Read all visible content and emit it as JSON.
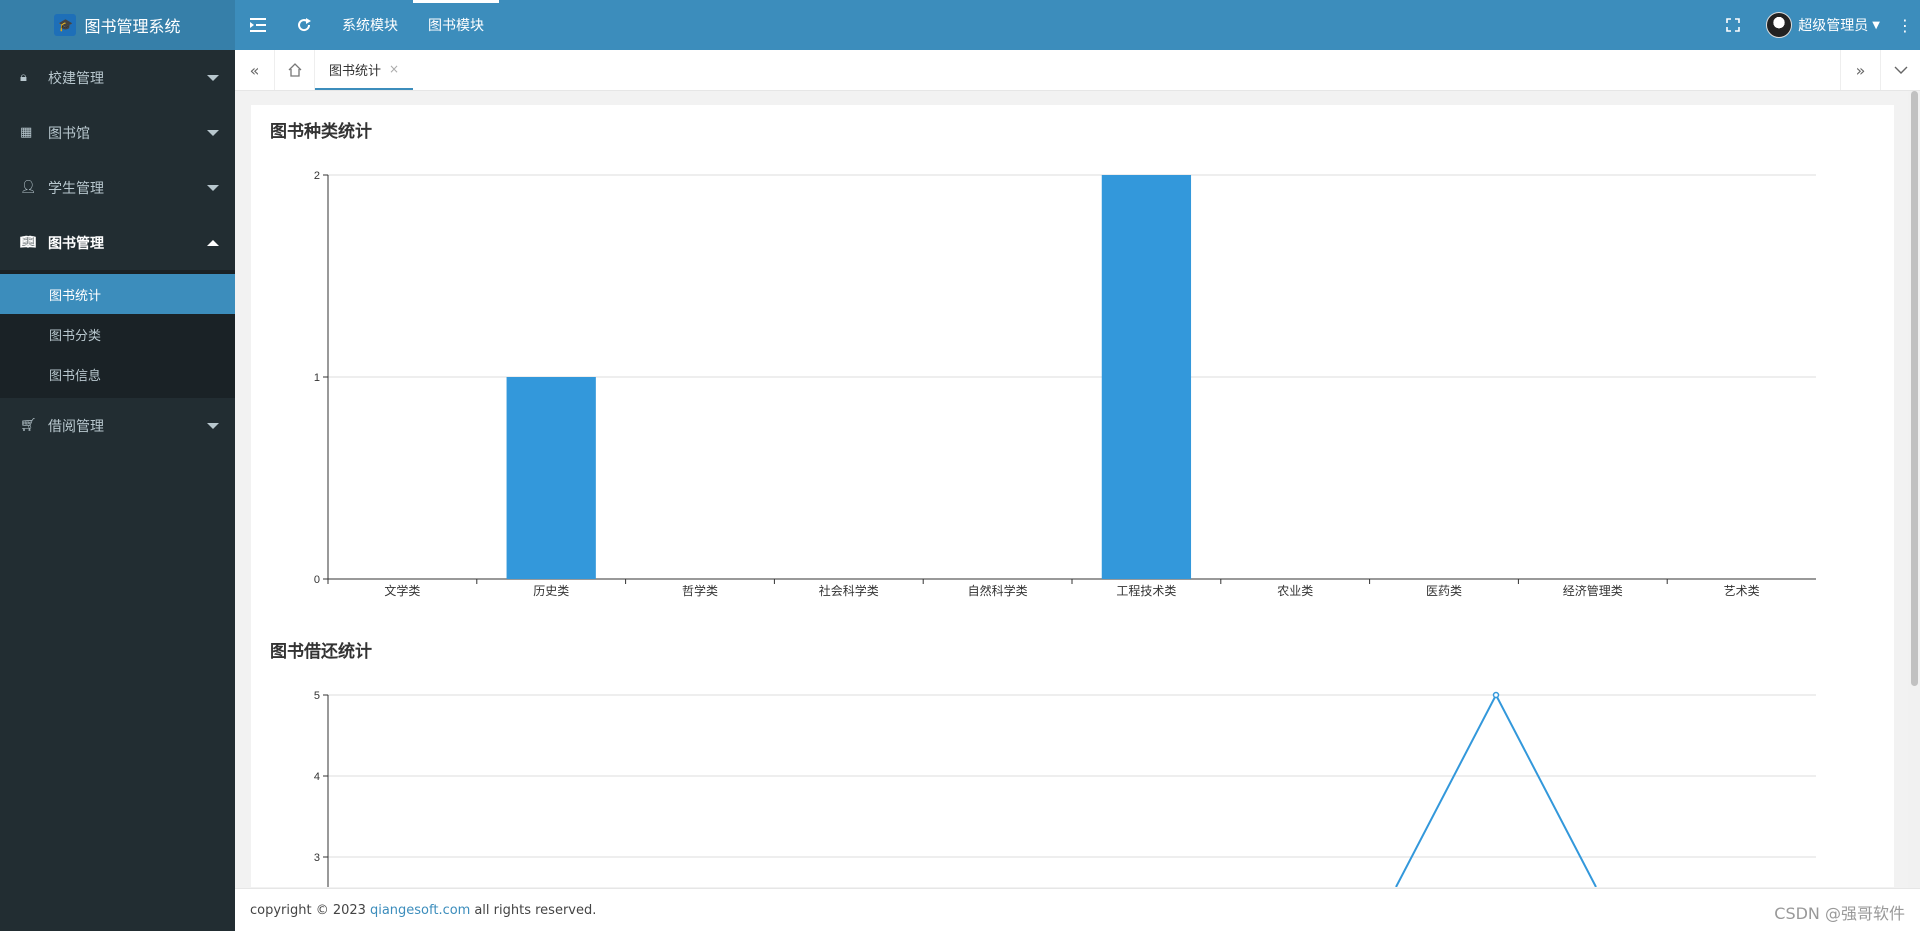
{
  "header": {
    "app_title": "图书管理系统",
    "nav": [
      "系统模块",
      "图书模块"
    ],
    "user_name": "超级管理员"
  },
  "sidebar": {
    "items": [
      {
        "label": "校建管理",
        "icon": "lock-icon"
      },
      {
        "label": "图书馆",
        "icon": "table-icon"
      },
      {
        "label": "学生管理",
        "icon": "user-icon"
      },
      {
        "label": "图书管理",
        "icon": "book-icon",
        "open": true,
        "children": [
          "图书统计",
          "图书分类",
          "图书信息"
        ]
      },
      {
        "label": "借阅管理",
        "icon": "cart-icon"
      }
    ]
  },
  "tabs": {
    "active": "图书统计"
  },
  "charts": {
    "category_title": "图书种类统计",
    "borrow_title": "图书借还统计"
  },
  "chart_data": [
    {
      "type": "bar",
      "title": "图书种类统计",
      "categories": [
        "文学类",
        "历史类",
        "哲学类",
        "社会科学类",
        "自然科学类",
        "工程技术类",
        "农业类",
        "医药类",
        "经济管理类",
        "艺术类"
      ],
      "values": [
        0,
        1,
        0,
        0,
        0,
        2,
        0,
        0,
        0,
        0
      ],
      "ylim": [
        0,
        2
      ],
      "yticks": [
        0,
        1,
        2
      ],
      "color": "#3398db",
      "grid": true
    },
    {
      "type": "line",
      "title": "图书借还统计",
      "yticks_visible": [
        3,
        4,
        5
      ],
      "ymax": 5,
      "peak_value": 5,
      "color": "#3398db",
      "grid": true
    }
  ],
  "footer": {
    "copyright_prefix": "copyright © 2023",
    "link": "qiangesoft.com",
    "suffix": "all rights reserved.",
    "watermark": "CSDN @强哥软件"
  }
}
